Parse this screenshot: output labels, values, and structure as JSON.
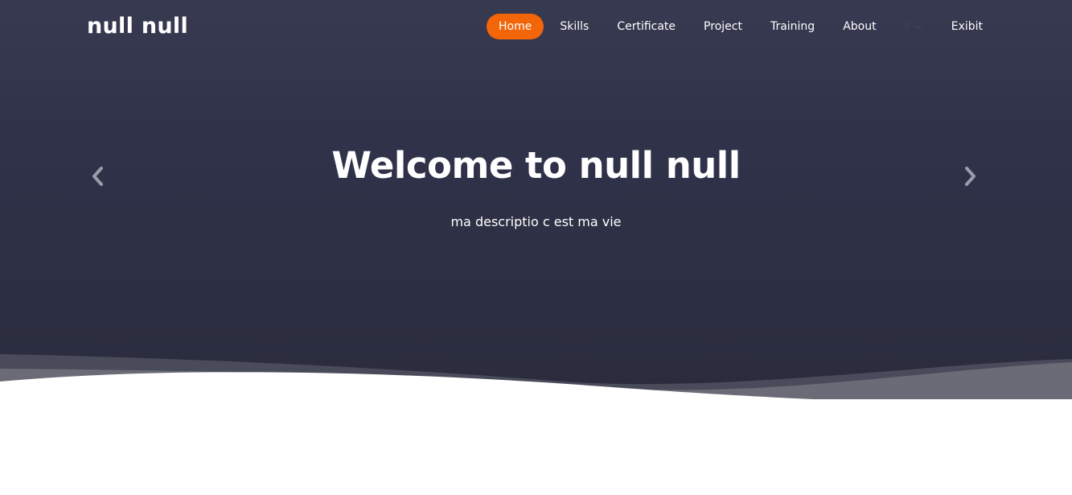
{
  "brand": {
    "name": "null null"
  },
  "nav": {
    "items": [
      {
        "label": "Home",
        "active": true
      },
      {
        "label": "Skills"
      },
      {
        "label": "Certificate"
      },
      {
        "label": "Project"
      },
      {
        "label": "Training"
      },
      {
        "label": "About"
      },
      {
        "label": "k",
        "dropdown": true
      },
      {
        "label": "Exibit"
      }
    ]
  },
  "hero": {
    "title": "Welcome to null null",
    "description": "ma descriptio c est ma vie",
    "prev_icon": "chevron-left-icon",
    "next_icon": "chevron-right-icon"
  },
  "colors": {
    "accent": "#f26508",
    "hero_bg_top": "#373a50",
    "hero_bg_bottom": "#2a2c3d",
    "wave_light": "#6a6b76",
    "wave_mid": "#4a4b5a"
  }
}
